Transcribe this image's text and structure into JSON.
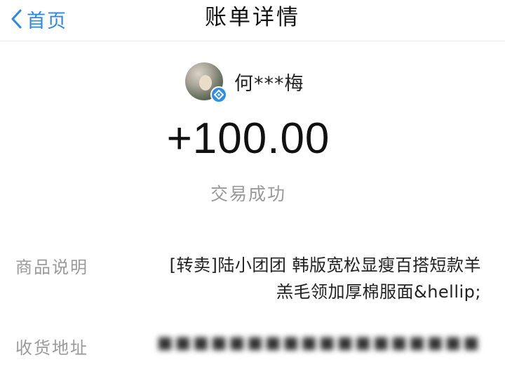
{
  "nav": {
    "back_label": "首页",
    "title": "账单详情"
  },
  "payer": {
    "name": "何***梅",
    "avatar_icon": "avatar-photo",
    "badge_icon": "verified-badge-icon"
  },
  "amount": "+100.00",
  "status": "交易成功",
  "details": {
    "goods_label": "商品说明",
    "goods_line1": "[转卖]陆小团团 韩版宽松显瘦百搭短款羊",
    "goods_line2": "羔毛领加厚棉服面&hellip;",
    "address_label": "收货地址"
  },
  "colors": {
    "accent": "#2a88e6",
    "muted": "#999999"
  }
}
